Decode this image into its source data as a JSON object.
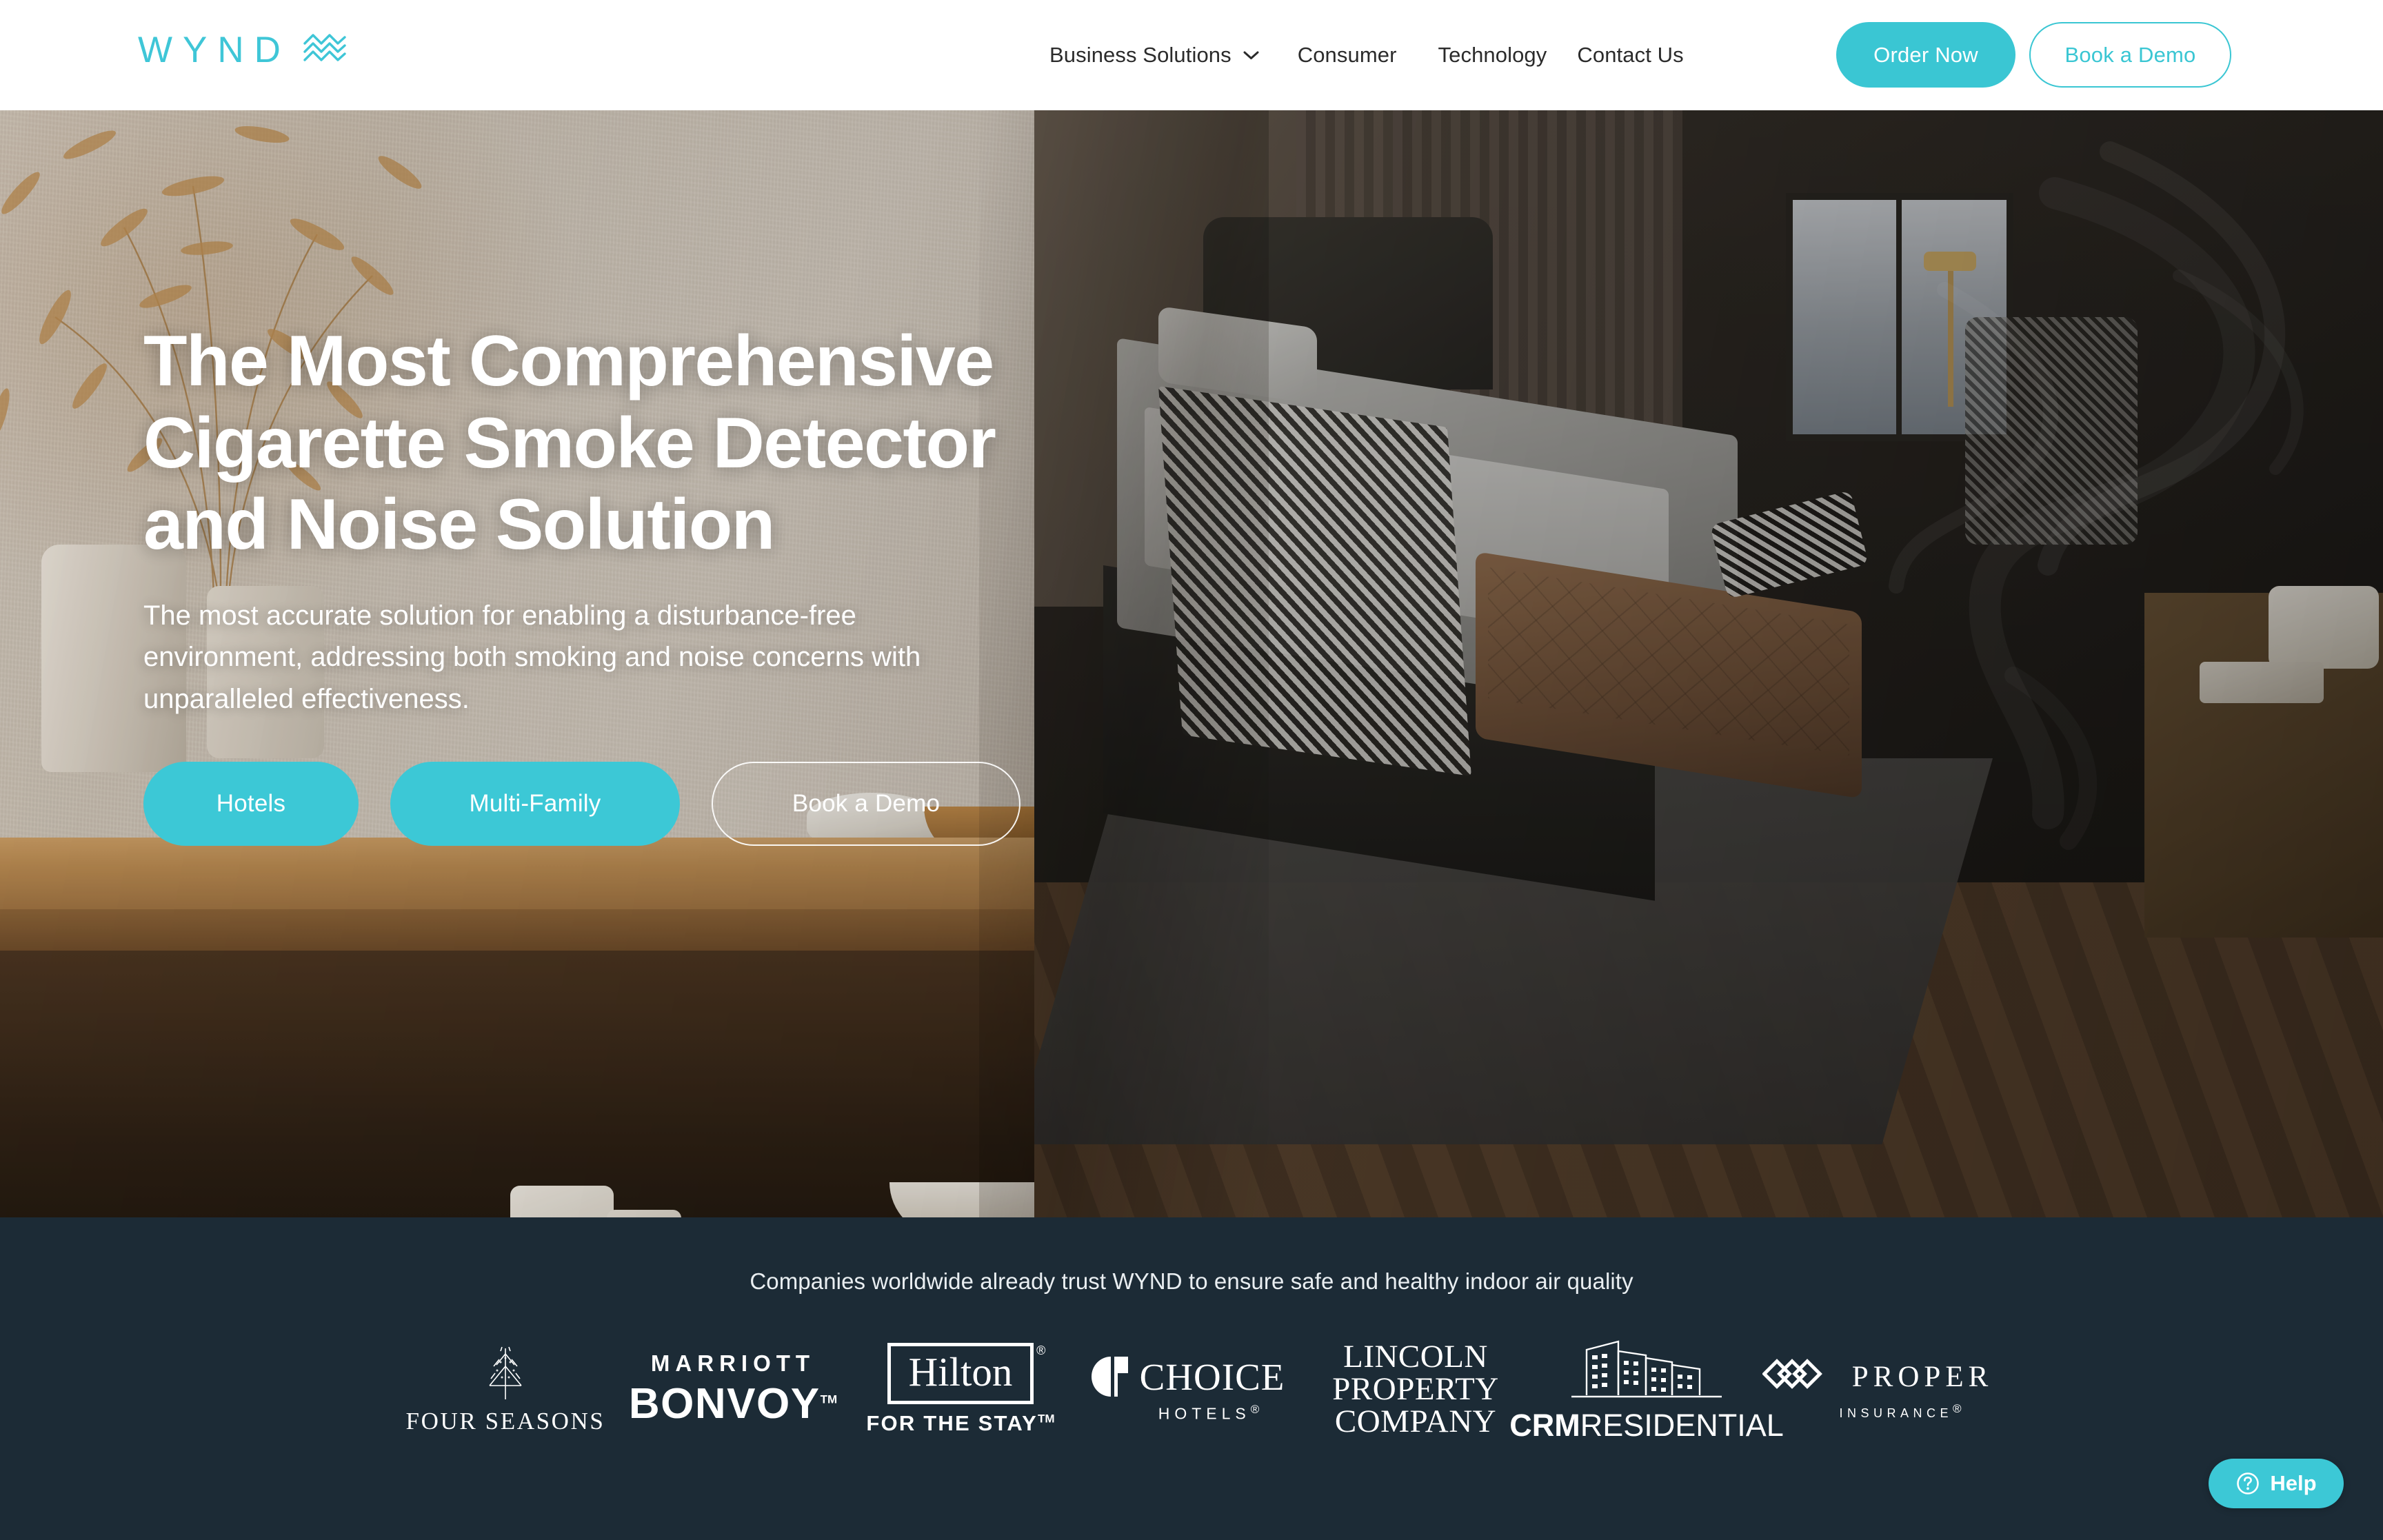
{
  "header": {
    "logo_text": "WYND",
    "logo_mark": "wave-zigzag-icon",
    "nav": [
      {
        "label": "Business Solutions",
        "has_dropdown": true
      },
      {
        "label": "Consumer",
        "has_dropdown": false
      },
      {
        "label": "Technology",
        "has_dropdown": false
      },
      {
        "label": "Contact Us",
        "has_dropdown": false
      }
    ],
    "order_button": "Order Now",
    "demo_button": "Book a Demo"
  },
  "hero": {
    "heading_line1": "The Most Comprehensive",
    "heading_line2": "Cigarette Smoke Detector",
    "heading_line3": "and Noise Solution",
    "subheading": "The most accurate solution for enabling a disturbance-free environment, addressing both smoking and noise concerns with unparalleled effectiveness.",
    "buttons": [
      {
        "label": "Hotels",
        "style": "filled"
      },
      {
        "label": "Multi-Family",
        "style": "filled"
      },
      {
        "label": "Book a Demo",
        "style": "outline"
      }
    ]
  },
  "trust_band": {
    "title": "Companies worldwide already trust WYND to ensure safe and healthy indoor air quality",
    "logos": [
      {
        "name": "Four Seasons",
        "wordmark": "FOUR SEASONS",
        "icon": "tree-icon"
      },
      {
        "name": "Marriott Bonvoy",
        "top": "MARRIOTT",
        "bottom": "BONVOY",
        "mark": "TM"
      },
      {
        "name": "Hilton",
        "wordmark": "Hilton",
        "tagline": "FOR THE STAY",
        "mark": "®",
        "tagline_mark": "TM"
      },
      {
        "name": "Choice Hotels",
        "wordmark": "CHOICE",
        "sub": "HOTELS",
        "mark": "®",
        "icon": "choice-semicircle-icon"
      },
      {
        "name": "Lincoln Property Company",
        "line1": "LINCOLN",
        "line2": "PROPERTY",
        "line3": "COMPANY"
      },
      {
        "name": "CRM Residential",
        "bold": "CRM",
        "light": "RESIDENTIAL",
        "icon": "buildings-icon"
      },
      {
        "name": "Proper Insurance",
        "wordmark": "PROPER",
        "sub": "INSURANCE",
        "mark": "®",
        "icon": "interlocking-diamonds-icon"
      }
    ]
  },
  "help_widget": {
    "label": "Help",
    "icon": "question-circle-icon"
  },
  "colors": {
    "accent_teal": "#3CC8D6",
    "band_navy": "#1C2B36",
    "nav_text": "#2B2B2B",
    "white": "#FFFFFF"
  }
}
